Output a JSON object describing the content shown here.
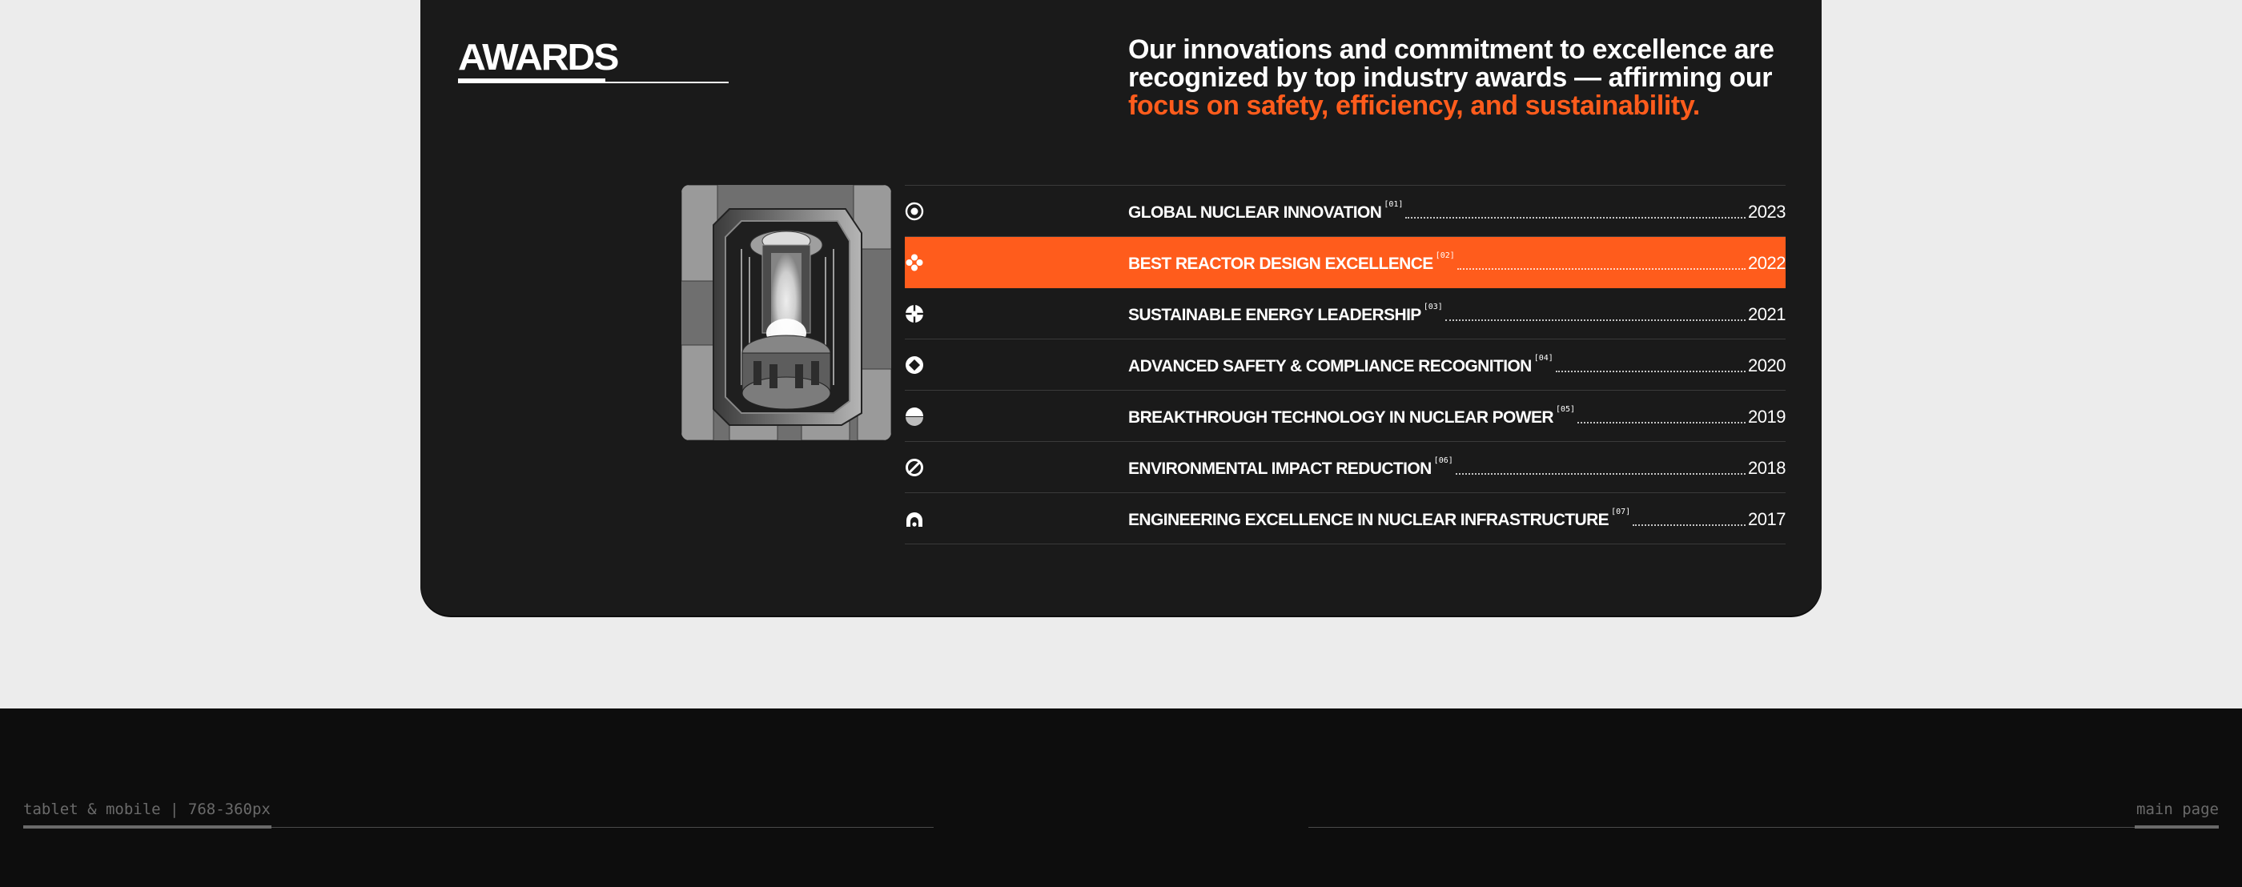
{
  "awards": {
    "title": "AWARDS",
    "intro_main": "Our innovations and commitment to excellence are recognized by top industry awards — affirming our",
    "intro_accent": "focus on safety, efficiency, and sustainability.",
    "accent_color": "#ff5c1c",
    "image_subject": "isometric nuclear reactor core illustration",
    "items": [
      {
        "name": "GLOBAL NUCLEAR INNOVATION",
        "num": "[01]",
        "year": "2023",
        "icon": "target-circle-icon",
        "active": false
      },
      {
        "name": "BEST REACTOR DESIGN EXCELLENCE",
        "num": "[02]",
        "year": "2022",
        "icon": "flower-icon",
        "active": true
      },
      {
        "name": "SUSTAINABLE ENERGY LEADERSHIP",
        "num": "[03]",
        "year": "2021",
        "icon": "crosshair-icon",
        "active": false
      },
      {
        "name": "ADVANCED SAFETY & COMPLIANCE RECOGNITION",
        "num": "[04]",
        "year": "2020",
        "icon": "diamond-cutout-icon",
        "active": false
      },
      {
        "name": "BREAKTHROUGH TECHNOLOGY IN NUCLEAR POWER",
        "num": "[05]",
        "year": "2019",
        "icon": "half-circle-icon",
        "active": false
      },
      {
        "name": "ENVIRONMENTAL IMPACT REDUCTION",
        "num": "[06]",
        "year": "2018",
        "icon": "slash-circle-icon",
        "active": false
      },
      {
        "name": "ENGINEERING EXCELLENCE IN NUCLEAR INFRASTRUCTURE",
        "num": "[07]",
        "year": "2017",
        "icon": "arch-icon",
        "active": false
      }
    ]
  },
  "footer": {
    "left_label": "tablet & mobile | 768-360px",
    "right_label": "main page"
  }
}
